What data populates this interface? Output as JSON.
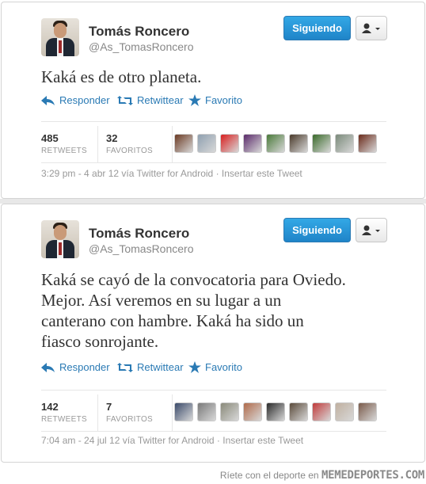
{
  "tweets": [
    {
      "user_name": "Tomás Roncero",
      "screen_name": "@As_TomasRoncero",
      "follow_label": "Siguiendo",
      "text": "Kaká es de otro planeta.",
      "actions": {
        "reply": "Responder",
        "retweet": "Retwittear",
        "favorite": "Favorito"
      },
      "retweets_count": "485",
      "retweets_label": "RETWEETS",
      "favorites_count": "32",
      "favorites_label": "FAVORITOS",
      "avatar_colors": [
        "#6b3a23",
        "#8fa0b0",
        "#d81f1f",
        "#5a2a6a",
        "#4a7a3a",
        "#4a3a2a",
        "#3a6a2a",
        "#7a8a7a",
        "#6a2a1a"
      ],
      "timestamp": "3:29 pm - 4 abr 12 vía Twitter for Android",
      "embed_label": "Insertar este Tweet"
    },
    {
      "user_name": "Tomás Roncero",
      "screen_name": "@As_TomasRoncero",
      "follow_label": "Siguiendo",
      "text_lines": [
        "Kaká se cayó de la convocatoria para Oviedo.",
        "Mejor. Así veremos en su lugar a un",
        "canterano con hambre. Kaká ha sido un",
        "fiasco sonrojante."
      ],
      "actions": {
        "reply": "Responder",
        "retweet": "Retwittear",
        "favorite": "Favorito"
      },
      "retweets_count": "142",
      "retweets_label": "RETWEETS",
      "favorites_count": "7",
      "favorites_label": "FAVORITOS",
      "avatar_colors": [
        "#3a4a6a",
        "#7a7a7a",
        "#8a8a7a",
        "#b06a4a",
        "#2a2a2a",
        "#5a4a3a",
        "#c03a3a",
        "#c0b0a0",
        "#7a5a4a"
      ],
      "timestamp": "7:04 am - 24 jul 12 vía Twitter for Android",
      "embed_label": "Insertar este Tweet"
    }
  ],
  "footer": {
    "tagline": "Ríete con el deporte en",
    "site": "MEMEDEPORTES.COM"
  },
  "colors": {
    "accent": "#2a7ab4",
    "follow_button": "#1f84c8"
  }
}
